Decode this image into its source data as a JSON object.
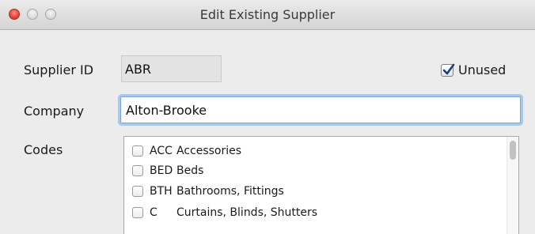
{
  "window": {
    "title": "Edit Existing Supplier"
  },
  "form": {
    "supplier_id_label": "Supplier ID",
    "supplier_id_value": "ABR",
    "unused_label": "Unused",
    "unused_checked": true,
    "company_label": "Company",
    "company_value": "Alton-Brooke",
    "codes_label": "Codes"
  },
  "codes": [
    {
      "code": "ACC",
      "name": "Accessories",
      "checked": false
    },
    {
      "code": "BED",
      "name": "Beds",
      "checked": false
    },
    {
      "code": "BTH",
      "name": "Bathrooms, Fittings",
      "checked": false
    },
    {
      "code": "C",
      "name": "Curtains, Blinds, Shutters",
      "checked": false
    }
  ],
  "colors": {
    "focus_ring": "#a9c8ee",
    "close_button": "#e0443a"
  }
}
